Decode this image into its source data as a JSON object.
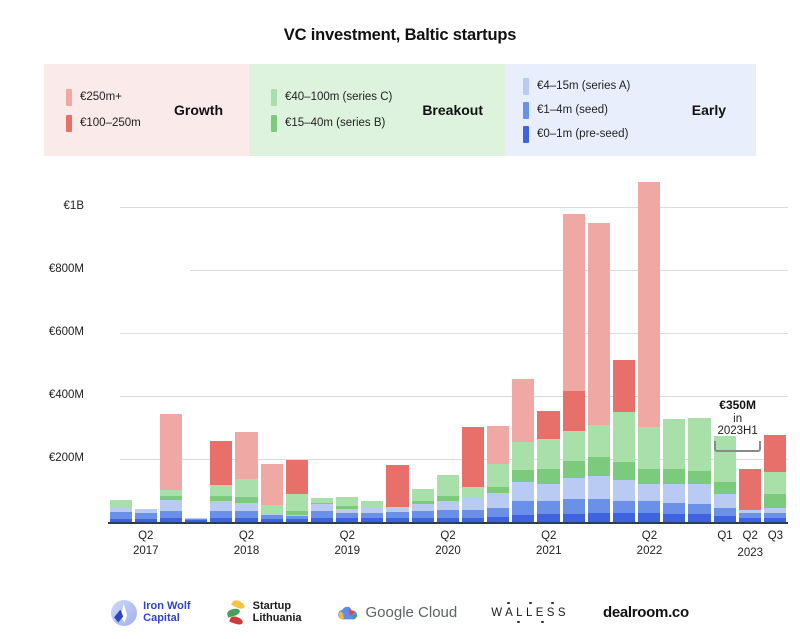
{
  "title": "VC investment, Baltic startups",
  "legend": {
    "groups": [
      {
        "stage": "Growth",
        "bg": "#fbeaea",
        "items": [
          {
            "label": "€250m+",
            "color": "#f0a8a4",
            "key": "250m_plus"
          },
          {
            "label": "€100–250m",
            "color": "#e8706a",
            "key": "100_250m"
          }
        ]
      },
      {
        "stage": "Breakout",
        "bg": "#ddf3dd",
        "items": [
          {
            "label": "€40–100m (series C)",
            "color": "#a9dfa9",
            "key": "series_c"
          },
          {
            "label": "€15–40m (series B)",
            "color": "#7ccb7c",
            "key": "series_b"
          }
        ]
      },
      {
        "stage": "Early",
        "bg": "#e8eefc",
        "items": [
          {
            "label": "€4–15m (series A)",
            "color": "#b9cbf2",
            "key": "series_a"
          },
          {
            "label": "€1–4m (seed)",
            "color": "#6a90e8",
            "key": "seed"
          },
          {
            "label": "€0–1m (pre-seed)",
            "color": "#3f63e0",
            "key": "pre_seed"
          }
        ]
      }
    ]
  },
  "annotation": {
    "value": "€350M",
    "subtitle": "in 2023H1",
    "spans_quarters": [
      "Q1 2023",
      "Q2 2023"
    ]
  },
  "footer": {
    "logos": [
      {
        "name": "iron-wolf-capital",
        "line1": "Iron Wolf",
        "line2": "Capital"
      },
      {
        "name": "startup-lithuania",
        "line1": "Startup",
        "line2": "Lithuania"
      },
      {
        "name": "google-cloud",
        "line1": "Google",
        "line2": "Cloud"
      },
      {
        "name": "walless",
        "line1": "WALLESS",
        "line2": ""
      },
      {
        "name": "dealroom",
        "line1": "dealroom.co",
        "line2": ""
      }
    ]
  },
  "chart_data": {
    "type": "bar",
    "stacked": true,
    "title": "VC investment, Baltic startups",
    "xlabel": "",
    "ylabel": "",
    "ylim": [
      0,
      1100
    ],
    "unit": "EUR millions",
    "grid": true,
    "legend_position": "top",
    "yticks": [
      200,
      400,
      600,
      800,
      1000
    ],
    "ytick_labels": [
      "€200M",
      "€400M",
      "€600M",
      "€800M",
      "€1B"
    ],
    "x": [
      "Q1 2017",
      "Q2 2017",
      "Q3 2017",
      "Q4 2017",
      "Q1 2018",
      "Q2 2018",
      "Q3 2018",
      "Q4 2018",
      "Q1 2019",
      "Q2 2019",
      "Q3 2019",
      "Q4 2019",
      "Q1 2020",
      "Q2 2020",
      "Q3 2020",
      "Q4 2020",
      "Q1 2021",
      "Q2 2021",
      "Q3 2021",
      "Q4 2021",
      "Q1 2022",
      "Q2 2022",
      "Q3 2022",
      "Q4 2022",
      "Q1 2023",
      "Q2 2023",
      "Q3 2023"
    ],
    "xtick_labels": [
      {
        "q": "Q2",
        "year": "2017",
        "index": 1
      },
      {
        "q": "Q2",
        "year": "2018",
        "index": 5
      },
      {
        "q": "Q2",
        "year": "2019",
        "index": 9
      },
      {
        "q": "Q2",
        "year": "2020",
        "index": 13
      },
      {
        "q": "Q2",
        "year": "2021",
        "index": 17
      },
      {
        "q": "Q2",
        "year": "2022",
        "index": 21
      },
      {
        "q": "Q1",
        "year": "2023",
        "index": 24
      },
      {
        "q": "Q2",
        "year": "2023",
        "index": 25
      },
      {
        "q": "Q3",
        "year": "2023",
        "index": 26
      }
    ],
    "series": [
      {
        "name": "€0–1m (pre-seed)",
        "stage": "Early",
        "color": "#3f63e0",
        "values": [
          10,
          10,
          12,
          6,
          12,
          14,
          10,
          8,
          14,
          12,
          12,
          14,
          14,
          14,
          14,
          16,
          22,
          26,
          26,
          28,
          28,
          28,
          26,
          24,
          18,
          14,
          14
        ]
      },
      {
        "name": "€1–4m (seed)",
        "stage": "Early",
        "color": "#6a90e8",
        "values": [
          22,
          18,
          22,
          4,
          24,
          22,
          12,
          10,
          20,
          16,
          16,
          18,
          22,
          24,
          24,
          30,
          46,
          40,
          46,
          44,
          40,
          38,
          36,
          34,
          26,
          14,
          16
        ]
      },
      {
        "name": "€4–15m (series A)",
        "stage": "Early",
        "color": "#b9cbf2",
        "values": [
          12,
          14,
          36,
          2,
          30,
          26,
          4,
          4,
          22,
          12,
          16,
          16,
          22,
          30,
          38,
          46,
          58,
          56,
          68,
          74,
          66,
          54,
          60,
          62,
          44,
          10,
          14
        ]
      },
      {
        "name": "€15–40m (series B)",
        "stage": "Breakout",
        "color": "#7ccb7c",
        "values": [
          0,
          0,
          14,
          0,
          18,
          18,
          0,
          14,
          4,
          10,
          0,
          0,
          10,
          14,
          0,
          18,
          40,
          46,
          54,
          62,
          56,
          48,
          46,
          42,
          38,
          0,
          44
        ]
      },
      {
        "name": "€40–100m (series C)",
        "stage": "Breakout",
        "color": "#a9dfa9",
        "values": [
          26,
          0,
          18,
          0,
          34,
          56,
          28,
          52,
          16,
          30,
          22,
          0,
          36,
          68,
          36,
          74,
          88,
          96,
          94,
          102,
          160,
          134,
          160,
          170,
          148,
          0,
          72
        ]
      },
      {
        "name": "€100–250m",
        "stage": "Growth",
        "color": "#e8706a",
        "values": [
          0,
          0,
          0,
          0,
          140,
          0,
          0,
          108,
          0,
          0,
          0,
          132,
          0,
          0,
          190,
          0,
          0,
          90,
          130,
          0,
          166,
          0,
          0,
          0,
          0,
          130,
          118
        ]
      },
      {
        "name": "€250m+",
        "stage": "Growth",
        "color": "#f0a8a4",
        "values": [
          0,
          0,
          240,
          0,
          0,
          150,
          130,
          0,
          0,
          0,
          0,
          0,
          0,
          0,
          0,
          120,
          200,
          0,
          560,
          640,
          0,
          780,
          0,
          0,
          0,
          0,
          0
        ]
      }
    ]
  }
}
